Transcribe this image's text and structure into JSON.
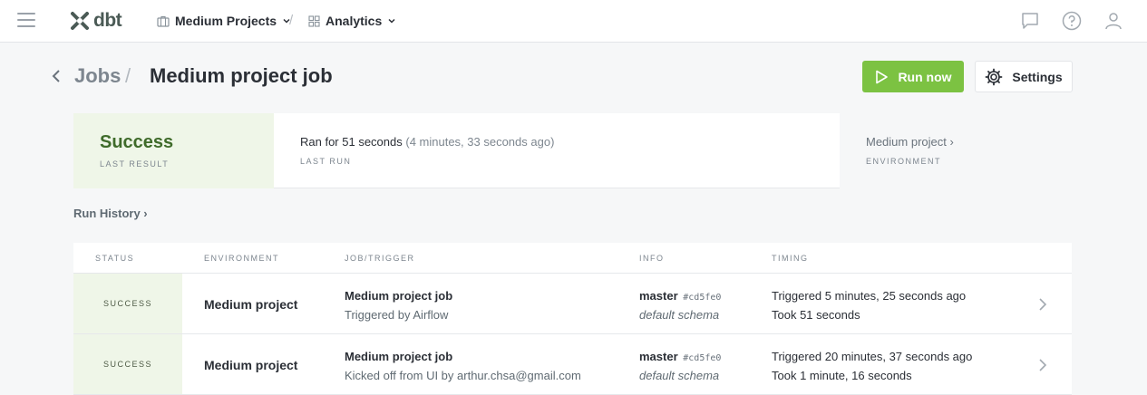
{
  "topnav": {
    "logo_text": "dbt",
    "project": "Medium Projects",
    "separator": "/",
    "section": "Analytics",
    "icons": [
      "menu-icon",
      "chat-icon",
      "help-icon",
      "user-icon"
    ]
  },
  "header": {
    "breadcrumb_parent": "Jobs",
    "breadcrumb_sep": "/",
    "title": "Medium project job",
    "run_now_label": "Run now",
    "settings_label": "Settings"
  },
  "summary": {
    "last_result_value": "Success",
    "last_result_label": "LAST RESULT",
    "last_run_text": "Ran for 51 seconds",
    "last_run_ago": "(4 minutes, 33 seconds ago)",
    "last_run_label": "LAST RUN",
    "environment_value": "Medium project ›",
    "environment_label": "ENVIRONMENT"
  },
  "run_history_label": "Run History ›",
  "table": {
    "headers": {
      "status": "STATUS",
      "environment": "ENVIRONMENT",
      "job": "JOB/TRIGGER",
      "info": "INFO",
      "timing": "TIMING"
    },
    "rows": [
      {
        "status": "SUCCESS",
        "environment": "Medium project",
        "job": "Medium project job",
        "trigger": "Triggered by Airflow",
        "branch": "master",
        "sha": "#cd5fe0",
        "schema": "default schema",
        "triggered": "Triggered 5 minutes, 25 seconds ago",
        "took": "Took 51 seconds"
      },
      {
        "status": "SUCCESS",
        "environment": "Medium project",
        "job": "Medium project job",
        "trigger": "Kicked off from UI by arthur.chsa@gmail.com",
        "branch": "master",
        "sha": "#cd5fe0",
        "schema": "default schema",
        "triggered": "Triggered 20 minutes, 37 seconds ago",
        "took": "Took 1 minute, 16 seconds"
      }
    ]
  },
  "colors": {
    "accent_green": "#7cc242",
    "success_bg": "#eff6e8",
    "success_text": "#3f6b2a"
  }
}
